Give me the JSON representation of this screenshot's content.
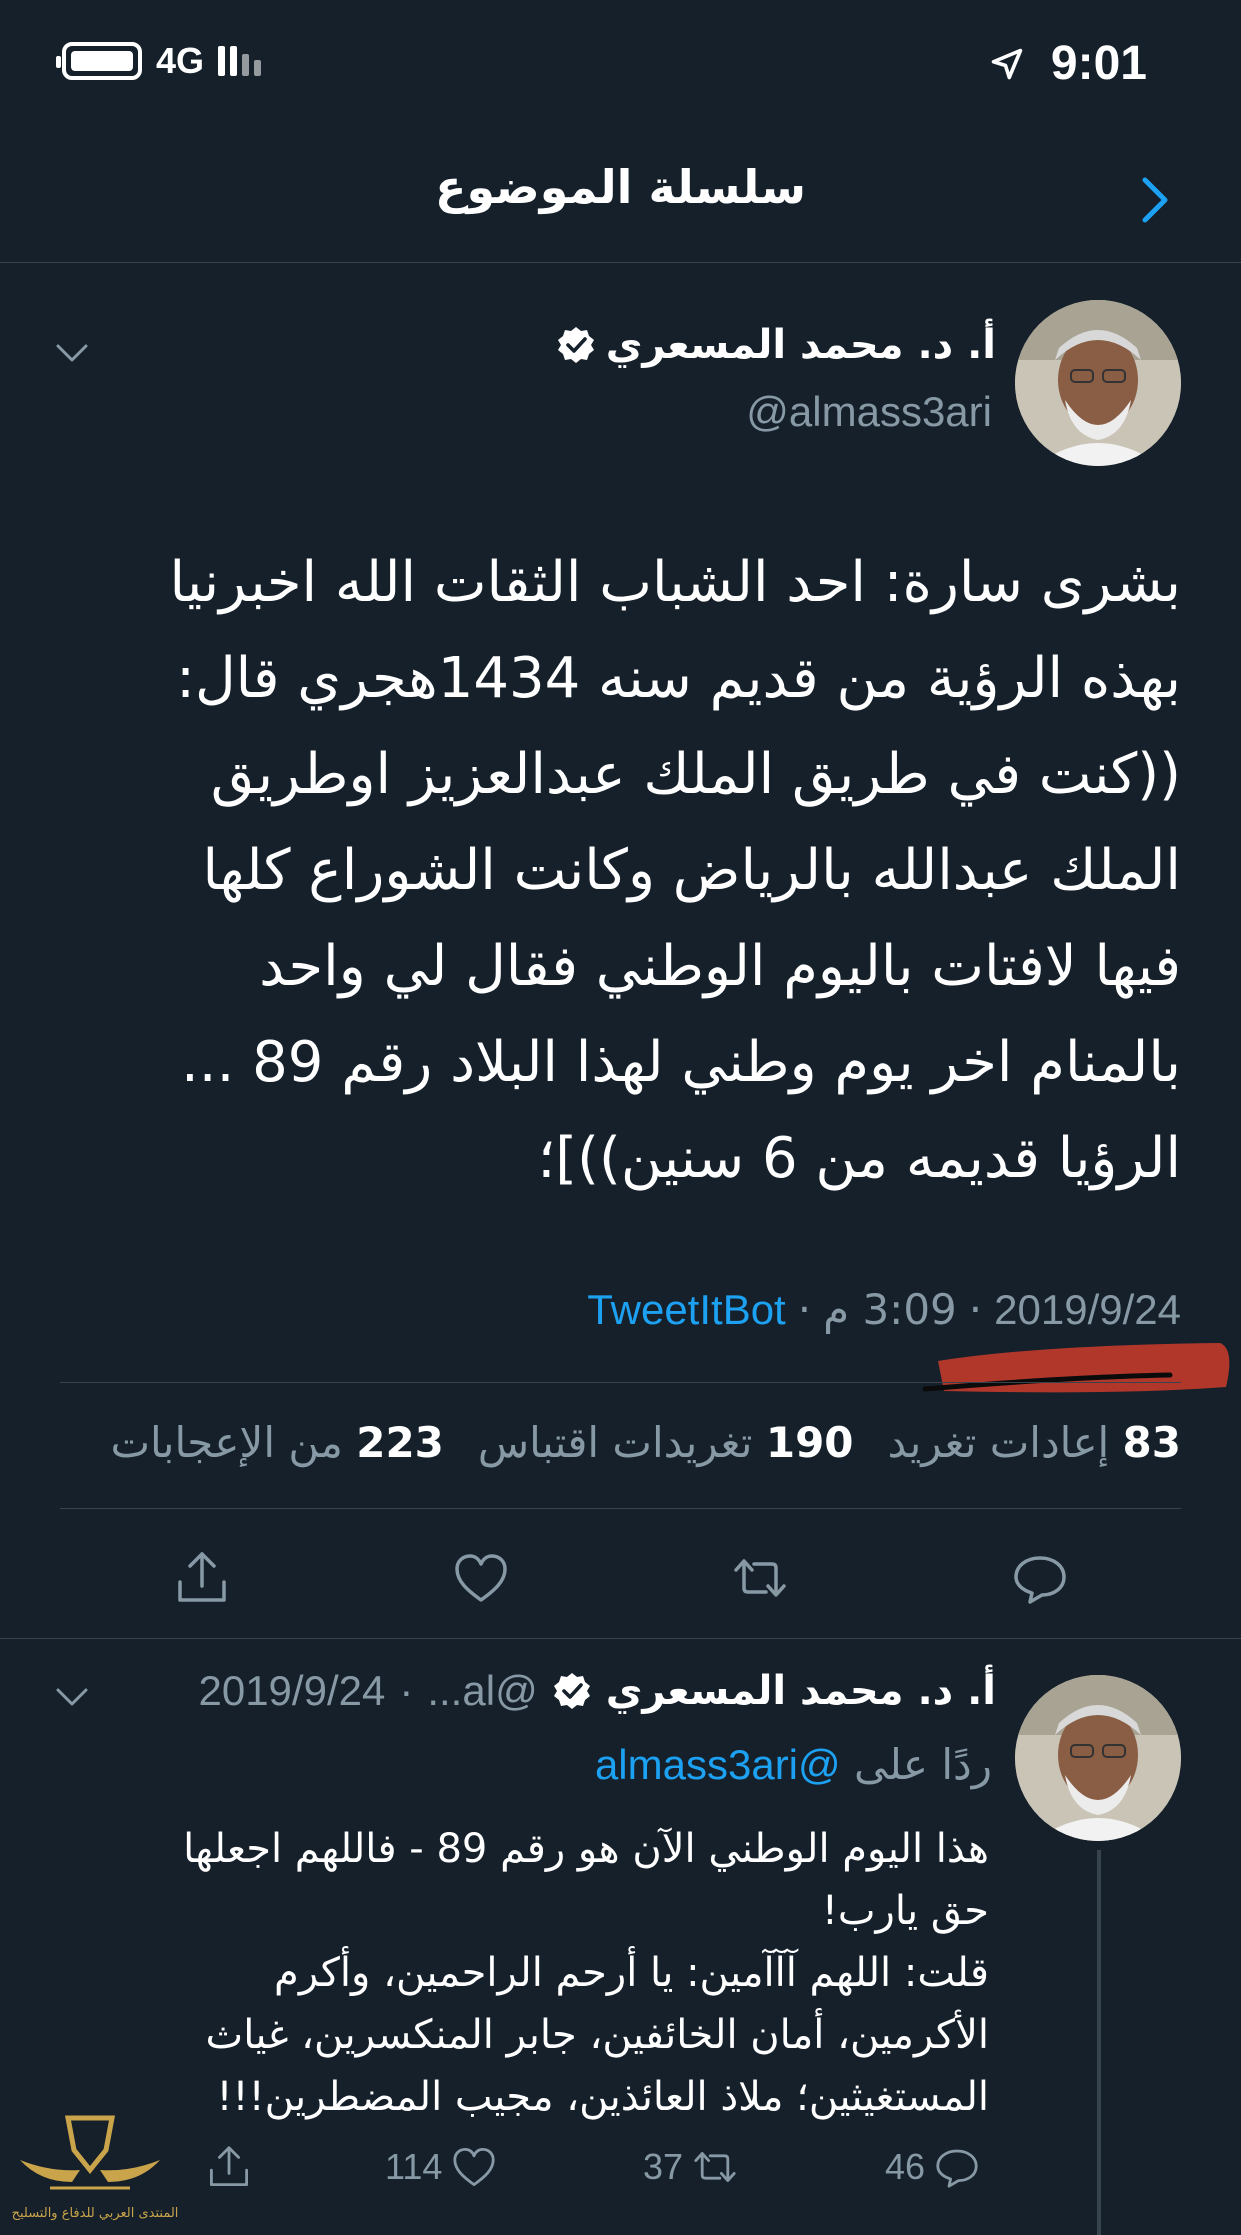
{
  "status_bar": {
    "network": "4G",
    "time": "9:01"
  },
  "header": {
    "title": "سلسلة الموضوع"
  },
  "tweet": {
    "author_name": "أ. د. محمد المسعري",
    "handle": "@almass3ari",
    "text": "بشرى سارة: احد الشباب الثقات الله اخبرنيا\nبهذه الرؤية من قديم سنه 1434هجري قال:\n((كنت في طريق الملك عبدالعزيز اوطريق\nالملك عبدالله بالرياض وكانت الشوراع كلها\nفيها لافتات باليوم الوطني فقال لي واحد\nبالمنام اخر يوم وطني لهذا البلاد رقم 89 ...\nالرؤيا قديمه من 6 سنين))]؛",
    "date": "2019/9/24",
    "time": "3:09 م",
    "separator": "·",
    "via": "TweetItBot",
    "stats": {
      "retweets_count": "83",
      "retweets_label": "إعادات تغريد",
      "quotes_count": "190",
      "quotes_label": "تغريدات اقتباس",
      "likes_count": "223",
      "likes_label": "من الإعجابات"
    }
  },
  "reply": {
    "author_name": "أ. د. محمد المسعري",
    "handle_truncated": "@al...",
    "separator": "·",
    "date": "2019/9/24",
    "replying_label": "ردًا على",
    "replying_to": "@almass3ari",
    "text": "هذا اليوم الوطني الآن هو رقم 89  -  فاللهم اجعلها\nحق يارب!\nقلت: اللهم آآآمين:  يا أرحم الراحمين، وأكرم\nالأكرمين، أمان الخائفين، جابر المنكسرين، غياث\nالمستغيثين؛ ملاذ العائذين، مجيب المضطرين!!!",
    "reply_count": "46",
    "retweet_count": "37",
    "like_count": "114"
  },
  "watermark": {
    "text": "المنتدى العربي للدفاع والتسليح"
  },
  "icons": [
    "battery-icon",
    "signal-icon",
    "location-arrow-icon",
    "back-chevron-icon",
    "verified-badge-icon",
    "chevron-down-icon",
    "reply-icon",
    "retweet-icon",
    "like-icon",
    "share-icon"
  ],
  "colors": {
    "background": "#15202b",
    "accent": "#1da1f2",
    "secondary_text": "#8899a6",
    "divider": "#38444d",
    "annotation_red": "#c0392b"
  }
}
